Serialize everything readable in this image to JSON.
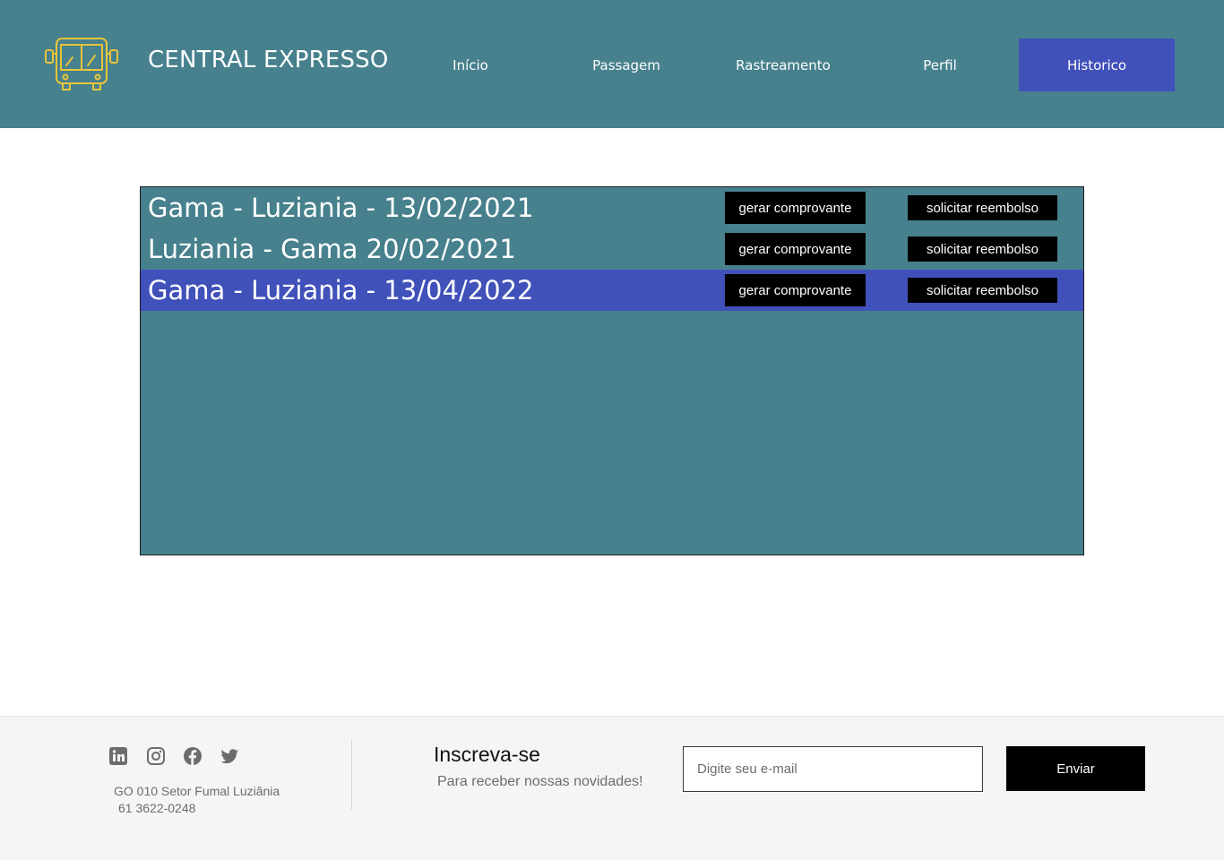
{
  "brand": {
    "name": "CENTRAL EXPRESSO",
    "logo_icon": "bus-icon",
    "logo_color": "#E8C53A"
  },
  "nav": {
    "items": [
      {
        "label": "Início"
      },
      {
        "label": "Passagem"
      },
      {
        "label": "Rastreamento"
      },
      {
        "label": "Perfil"
      },
      {
        "label": "Historico",
        "active": true
      }
    ]
  },
  "history": {
    "trips": [
      {
        "label": "Gama - Luziania - 13/02/2021",
        "receipt_label": "gerar comprovante",
        "refund_label": "solicitar reembolso"
      },
      {
        "label": "Luziania - Gama 20/02/2021",
        "receipt_label": "gerar comprovante",
        "refund_label": "solicitar reembolso"
      },
      {
        "label": "Gama - Luziania - 13/04/2022",
        "receipt_label": "gerar comprovante",
        "refund_label": "solicitar reembolso",
        "selected": true
      }
    ]
  },
  "footer": {
    "social_icons": [
      "linkedin-icon",
      "instagram-icon",
      "facebook-icon",
      "twitter-icon"
    ],
    "address": "GO 010 Setor Fumal Luziânia",
    "phone": "61 3622-0248",
    "subscribe_title": "Inscreva-se",
    "subscribe_subtitle": "Para receber nossas novidades!",
    "email_placeholder": "Digite seu e-mail",
    "send_label": "Enviar"
  },
  "colors": {
    "header_bg": "#47818D",
    "accent": "#4151BA",
    "button_bg": "#000000",
    "footer_bg": "#F4F5F7"
  }
}
